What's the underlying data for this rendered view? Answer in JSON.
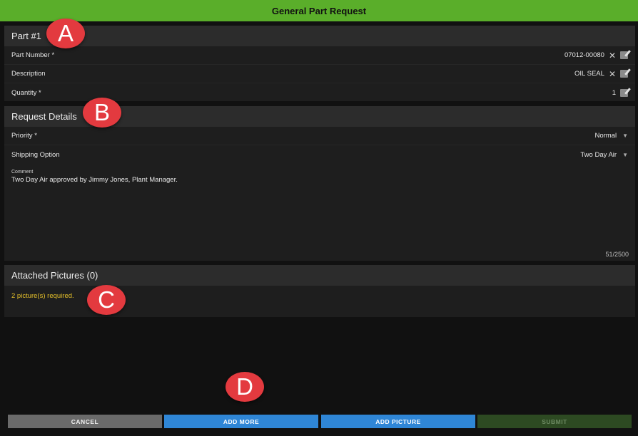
{
  "window": {
    "title": "General Part Request"
  },
  "part": {
    "header": "Part #1",
    "rows": [
      {
        "label": "Part Number *",
        "value": "07012-00080"
      },
      {
        "label": "Description",
        "value": "OIL SEAL"
      },
      {
        "label": "Quantity *",
        "value": "1"
      }
    ]
  },
  "request": {
    "header": "Request Details",
    "priority": {
      "label": "Priority *",
      "value": "Normal"
    },
    "shipping": {
      "label": "Shipping Option",
      "value": "Two Day Air"
    },
    "comment": {
      "label": "Comment",
      "text": "Two Day Air approved by Jimmy Jones, Plant Manager.",
      "counter": "51/2500"
    }
  },
  "pictures": {
    "header": "Attached Pictures (0)",
    "warning": "2 picture(s) required."
  },
  "markers": [
    "A",
    "B",
    "C",
    "D"
  ],
  "buttons": {
    "cancel": "CANCEL",
    "add_more": "ADD MORE",
    "add_picture": "ADD PICTURE",
    "submit": "SUBMIT"
  },
  "colors": {
    "title_bar": "#5aae2a",
    "marker": "#e33a3f",
    "warning": "#e6c12a",
    "primary_button": "#2f86d6",
    "cancel_button": "#6a6a6a",
    "submit_button_disabled": "#2d4a22"
  }
}
